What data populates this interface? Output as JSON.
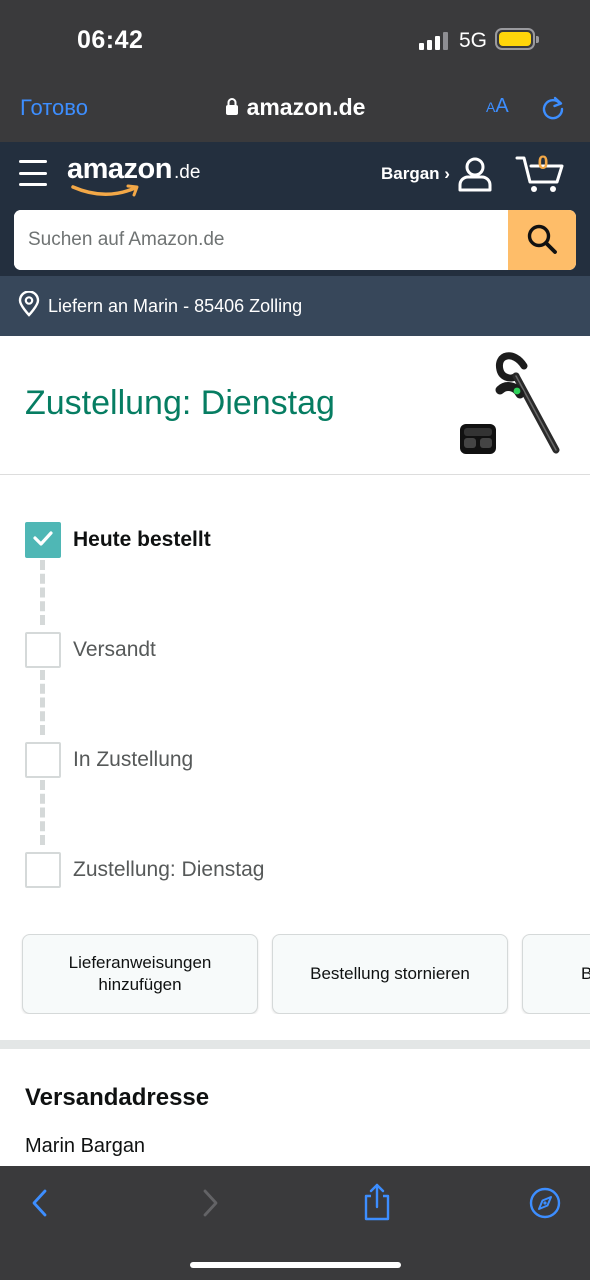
{
  "status_bar": {
    "time": "06:42",
    "network": "5G"
  },
  "browser": {
    "done_label": "Готово",
    "url": "amazon.de",
    "text_size_label_small": "A",
    "text_size_label_large": "A"
  },
  "header": {
    "logo_word": "amazon",
    "logo_tld": ".de",
    "account_label": "Bargan ›",
    "cart_count": "0"
  },
  "search": {
    "placeholder": "Suchen auf Amazon.de"
  },
  "deliver_to": {
    "text": "Liefern an Marin - 85406 Zolling"
  },
  "delivery": {
    "headline": "Zustellung: Dienstag"
  },
  "tracker": {
    "steps": [
      {
        "label": "Heute bestellt",
        "completed": true
      },
      {
        "label": "Versandt",
        "completed": false
      },
      {
        "label": "In Zustellung",
        "completed": false
      },
      {
        "label": "Zustellung: Dienstag",
        "completed": false
      }
    ]
  },
  "actions": {
    "buttons": [
      {
        "label": "Lieferanweisungen hinzufügen"
      },
      {
        "label": "Bestellung stornieren"
      },
      {
        "label": "B"
      }
    ]
  },
  "shipping_address": {
    "title": "Versandadresse",
    "name": "Marin Bargan"
  },
  "icons": {
    "lock": "lock-icon",
    "reload": "reload-icon",
    "menu": "menu-icon",
    "user": "user-icon",
    "cart": "cart-icon",
    "search": "search-icon",
    "pin": "location-pin-icon",
    "check": "check-icon",
    "back": "chevron-left-icon",
    "forward": "chevron-right-icon",
    "share": "share-icon",
    "compass": "compass-icon"
  },
  "colors": {
    "amazon_navy": "#232f3e",
    "deliver_bar": "#37475a",
    "search_button": "#febd69",
    "headline_green": "#067d62",
    "check_teal": "#4fb7b5",
    "ios_blue": "#3d8eff",
    "cart_orange": "#f3a847"
  }
}
